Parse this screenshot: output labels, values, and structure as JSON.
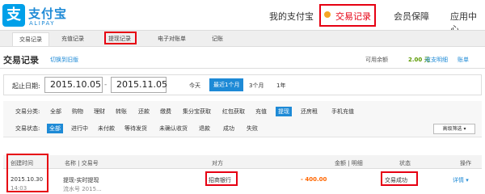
{
  "logo": {
    "mark": "支",
    "cn": "支付宝",
    "en": "ALIPAY"
  },
  "nav": {
    "my": "我的支付宝",
    "trade": "交易记录",
    "protect": "会员保障",
    "apps": "应用中心"
  },
  "tabs": [
    "交易记录",
    "充值记录",
    "提现记录",
    "电子对账单",
    "记账"
  ],
  "title": "交易记录",
  "switch_link": "切换到旧版",
  "balance": {
    "label": "可用余额",
    "value": "2.00 元",
    "income_link": "收支明细",
    "bill_link": "账单"
  },
  "date": {
    "label": "起止日期:",
    "start": "2015.10.05",
    "dash": "-",
    "end": "2015.11.05"
  },
  "quick_ranges": [
    "今天",
    "最近1个月",
    "3个月",
    "1年"
  ],
  "filters": {
    "type_label": "交易分类:",
    "type_options": [
      "全部",
      "购物",
      "理财",
      "转账",
      "还款",
      "缴费",
      "集分宝获取",
      "红包获取",
      "充值",
      "提现",
      "还房租",
      "手机充值"
    ],
    "status_label": "交易状态:",
    "status_options": [
      "全部",
      "进行中",
      "未付款",
      "等待发货",
      "未确认收货",
      "退款",
      "成功",
      "失败"
    ],
    "advanced": "高级筛选 ▾"
  },
  "table": {
    "headers": [
      "创建时间",
      "名称 | 交易号",
      "对方",
      "金额 | 明细",
      "状态",
      "操作"
    ],
    "rows": [
      {
        "date": "2015.10.30",
        "time": "14:03",
        "name": "提现-实时提现",
        "trade_no": "流水号 2015...",
        "counterparty": "招商银行",
        "amount": "- 400.00",
        "status": "交易成功",
        "action": "详情 ▾"
      }
    ]
  },
  "colors": {
    "accent": "#1e8ad6",
    "highlight": "#e60012",
    "negative": "#ff6600"
  }
}
